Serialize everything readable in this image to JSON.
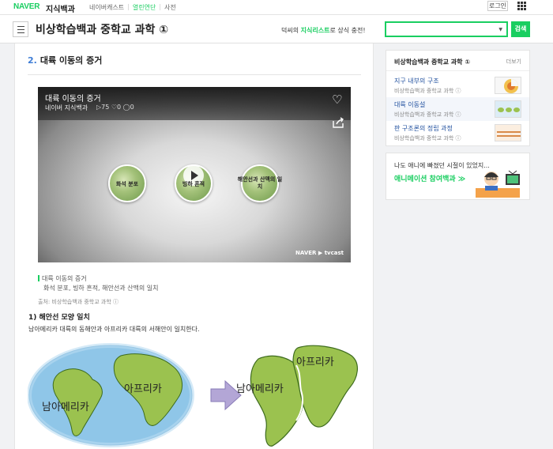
{
  "topbar": {
    "logo": "NAVER",
    "service": "지식백과",
    "nav": [
      "네이버캐스트",
      "열린연단",
      "사전"
    ],
    "active_nav": "열린연단",
    "login_label": "로그인"
  },
  "header": {
    "title": "비상학습백과 중학교 과학 ①",
    "promo_prefix": "덕씨의 ",
    "promo_highlight": "지식리스트",
    "promo_suffix": "로 상식 충전!",
    "search_value": "",
    "search_button": "검색"
  },
  "section": {
    "number": "2.",
    "title": "대륙 이동의 증거"
  },
  "video": {
    "title": "대륙 이동의 증거",
    "channel": "네이버 지식백과",
    "stats": "▷75 ♡0 ◯0",
    "circles": [
      "화석 분포",
      "빙하 흔적",
      "해안선과 산맥의 일치"
    ],
    "brand": "NAVER ▶ tvcast"
  },
  "caption": {
    "title": "대륙 이동의 증거",
    "subtitle": "화석 분포, 빙하 흔적, 해안선과 산맥의 일치",
    "source": "출처: 비상학습백과 중학교 과학 ⓘ"
  },
  "content": {
    "subheading": "1) 해안선 모양 일치",
    "body": "남아메리카 대륙의 동해안과 아프리카 대륙의 서해안이 일치한다.",
    "left_label_sa": "남아메리카",
    "left_label_af": "아프리카",
    "right_label_sa": "남아메리카",
    "right_label_af": "아프리카"
  },
  "sidebar": {
    "heading": "비상학습백과 중학교 과학 ①",
    "more": "더보기",
    "items": [
      {
        "title": "지구 내부의 구조",
        "source": "비상학습백과 중학교 과학 ⓘ",
        "selected": false
      },
      {
        "title": "대륙 이동설",
        "source": "비상학습백과 중학교 과학 ⓘ",
        "selected": true
      },
      {
        "title": "판 구조론의 정립 과정",
        "source": "비상학습백과 중학교 과학 ⓘ",
        "selected": false
      }
    ]
  },
  "ad": {
    "line1": "나도 애니에 빠졌던 시절이 있었지...",
    "line2": "애니메이션 참여백과 ≫"
  },
  "colors": {
    "brand_green": "#19ce60",
    "link_blue": "#1f4f9e",
    "section_number_blue": "#3e7dd6"
  }
}
